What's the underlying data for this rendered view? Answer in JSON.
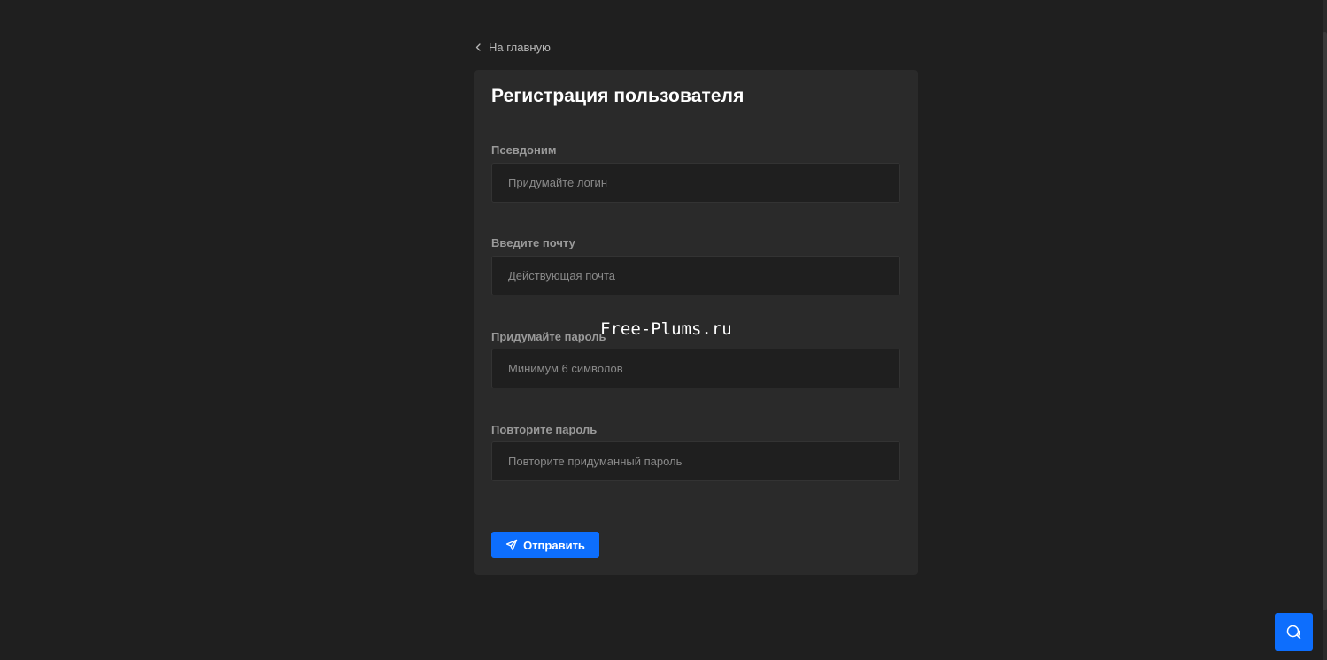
{
  "nav": {
    "back_label": "На главную",
    "back_icon": "chevron-left-icon"
  },
  "form": {
    "title": "Регистрация пользователя",
    "fields": [
      {
        "label": "Псевдоним",
        "placeholder": "Придумайте логин",
        "value": ""
      },
      {
        "label": "Введите почту",
        "placeholder": "Действующая почта",
        "value": ""
      },
      {
        "label": "Придумайте пароль",
        "placeholder": "Минимум 6 символов",
        "value": ""
      },
      {
        "label": "Повторите пароль",
        "placeholder": "Повторите придуманный пароль",
        "value": ""
      }
    ],
    "submit_label": "Отправить",
    "submit_icon": "send-icon"
  },
  "overlay": {
    "watermark": "Free-Plums.ru"
  },
  "chat": {
    "icon": "chat-icon"
  },
  "colors": {
    "background": "#1f1f1f",
    "card": "#2a2a2a",
    "accent": "#0d6efd"
  }
}
